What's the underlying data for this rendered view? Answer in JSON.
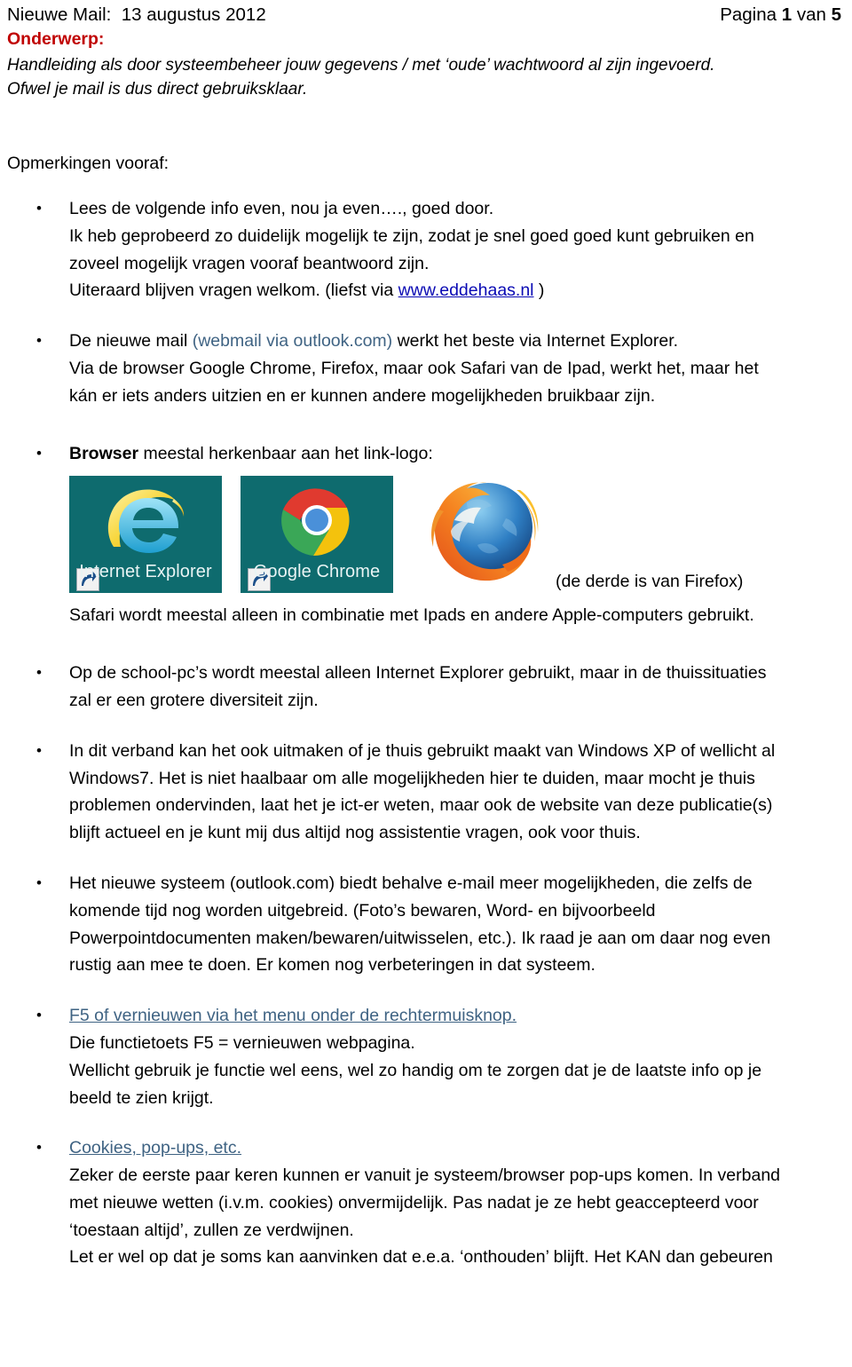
{
  "header": {
    "left": "Nieuwe Mail:  13 augustus 2012",
    "page_prefix": "Pagina ",
    "page_current": "1",
    "page_middle": " van ",
    "page_total": "5"
  },
  "subject": {
    "label": "Onderwerp:",
    "line1": "Handleiding als door systeembeheer jouw gegevens / met ‘oude’ wachtwoord al zijn ingevoerd.",
    "line2": "Ofwel je mail is dus direct gebruiksklaar."
  },
  "intro": "Opmerkingen vooraf:",
  "bullets": {
    "b1": {
      "l1": "Lees de volgende info even, nou ja even…., goed door.",
      "l2": "Ik heb geprobeerd zo duidelijk mogelijk te zijn, zodat je snel goed goed kunt gebruiken en",
      "l3": "zoveel mogelijk vragen vooraf beantwoord zijn.",
      "l4_pre": "Uiteraard blijven vragen welkom. (liefst via ",
      "l4_link": "www.eddehaas.nl",
      "l4_post": " )"
    },
    "b2": {
      "l1_pre": "De nieuwe mail ",
      "l1_mid": "(webmail via outlook.com)",
      "l1_post": " werkt het beste via Internet Explorer.",
      "l2": "Via de browser Google Chrome, Firefox, maar ook Safari van de Ipad, werkt het, maar het",
      "l3": "kán er iets anders uitzien en er kunnen andere mogelijkheden bruikbaar zijn."
    },
    "b3": {
      "l1_bold": "Browser",
      "l1_rest": " meestal herkenbaar aan het link-logo:",
      "tile_ie": "Internet Explorer",
      "tile_chrome": "Google Chrome",
      "caption_firefox": "(de derde is van Firefox)",
      "l2": "Safari wordt meestal alleen in combinatie met Ipads en andere Apple-computers gebruikt."
    },
    "b4": {
      "l1": "Op de school-pc’s wordt meestal alleen Internet Explorer gebruikt, maar in de thuissituaties",
      "l2": "zal er een grotere diversiteit zijn."
    },
    "b5": {
      "l1": "In dit verband kan het ook uitmaken of je thuis gebruikt maakt van Windows XP of wellicht al",
      "l2": "Windows7. Het is niet haalbaar om alle mogelijkheden hier te duiden, maar mocht je thuis",
      "l3": "problemen ondervinden, laat het je ict-er weten, maar ook de website van deze publicatie(s)",
      "l4": "blijft actueel en je kunt mij dus altijd nog assistentie vragen, ook voor thuis."
    },
    "b6": {
      "l1": "Het nieuwe systeem (outlook.com) biedt behalve e-mail meer mogelijkheden, die zelfs de",
      "l2": "komende tijd nog worden uitgebreid. (Foto’s bewaren, Word- en bijvoorbeeld",
      "l3": "Powerpointdocumenten maken/bewaren/uitwisselen, etc.). Ik raad je aan om daar nog even",
      "l4": "rustig aan mee te doen. Er komen nog verbeteringen in dat systeem."
    },
    "b7": {
      "l1_link": "F5 of vernieuwen via het menu onder de rechtermuisknop.",
      "l2": "Die functietoets F5 = vernieuwen webpagina.",
      "l3": "Wellicht gebruik je functie wel eens, wel zo handig om te zorgen dat je de laatste info op je",
      "l4": "beeld te zien krijgt."
    },
    "b8": {
      "l1_link": "Cookies, pop-ups, etc.",
      "l2": "Zeker de eerste paar keren kunnen er vanuit je systeem/browser pop-ups komen. In verband",
      "l3": "met nieuwe wetten (i.v.m. cookies) onvermijdelijk. Pas nadat je ze hebt geaccepteerd voor",
      "l4": "‘toestaan altijd’, zullen ze verdwijnen.",
      "l5": "Let er wel op dat je soms kan aanvinken dat e.e.a. ‘onthouden’ blijft. Het KAN dan gebeuren"
    }
  },
  "colors": {
    "subject_red": "#C00000",
    "link_blue": "#0A0AB4",
    "link_steel": "#3F6383",
    "tile_teal": "#0E6B6E"
  }
}
